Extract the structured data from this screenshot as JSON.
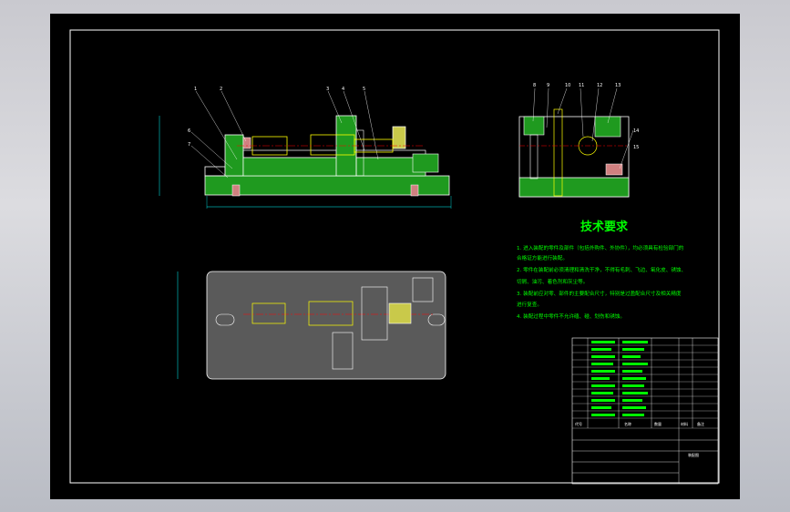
{
  "drawing": {
    "tech_title": "技术要求",
    "tech_lines": [
      "1. 进入装配的零件及部件（包括外购件、外协件），均必须具有检验部门的",
      "合格证方能进行装配。",
      "2. 零件在装配前必须清理和清洗干净，不得有毛刺、飞边、氧化皮、锈蚀、",
      "切屑、油污、着色剂和灰尘等。",
      "3. 装配前应对零、部件的主要配合尺寸，特别是过盈配合尺寸及相关精度",
      "进行复查。",
      "4. 装配过程中零件不允许磕、碰、划伤和锈蚀。"
    ],
    "front_view_callouts": [
      "1",
      "2",
      "3",
      "4",
      "5",
      "6",
      "7"
    ],
    "side_view_callouts": [
      "8",
      "9",
      "10",
      "11",
      "12",
      "13",
      "14",
      "15"
    ],
    "title_block": {
      "col_code": "代号",
      "col_name": "名称",
      "col_qty": "数量",
      "col_material": "材料",
      "col_remark": "备注",
      "name_box": "装配图"
    },
    "colors": {
      "background": "#000000",
      "outline": "#ffffff",
      "hatch": "#00ff00",
      "rods": "#ffff00",
      "centerline": "#ff0000",
      "dimension": "#00ffff",
      "text": "#00ff00"
    }
  }
}
